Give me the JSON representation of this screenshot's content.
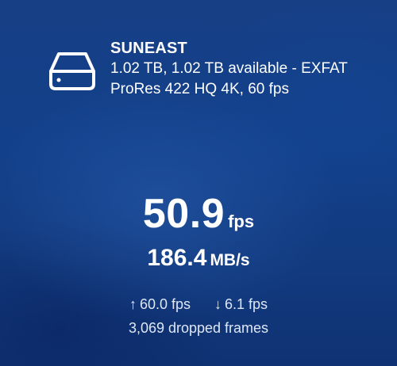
{
  "drive": {
    "name": "SUNEAST",
    "capacity": "1.02 TB, 1.02 TB available - EXFAT",
    "format": "ProRes 422 HQ 4K, 60 fps",
    "icon": "hard-drive-icon"
  },
  "speed": {
    "fps_value": "50.9",
    "fps_unit": "fps",
    "throughput_value": "186.4",
    "throughput_unit": "MB/s"
  },
  "stats": {
    "up_arrow": "↑",
    "up_rate": "60.0 fps",
    "down_arrow": "↓",
    "down_rate": "6.1 fps",
    "dropped": "3,069 dropped frames"
  },
  "colors": {
    "background": "#143e84",
    "text": "#ffffff",
    "secondary_text": "#dfe7f5"
  }
}
